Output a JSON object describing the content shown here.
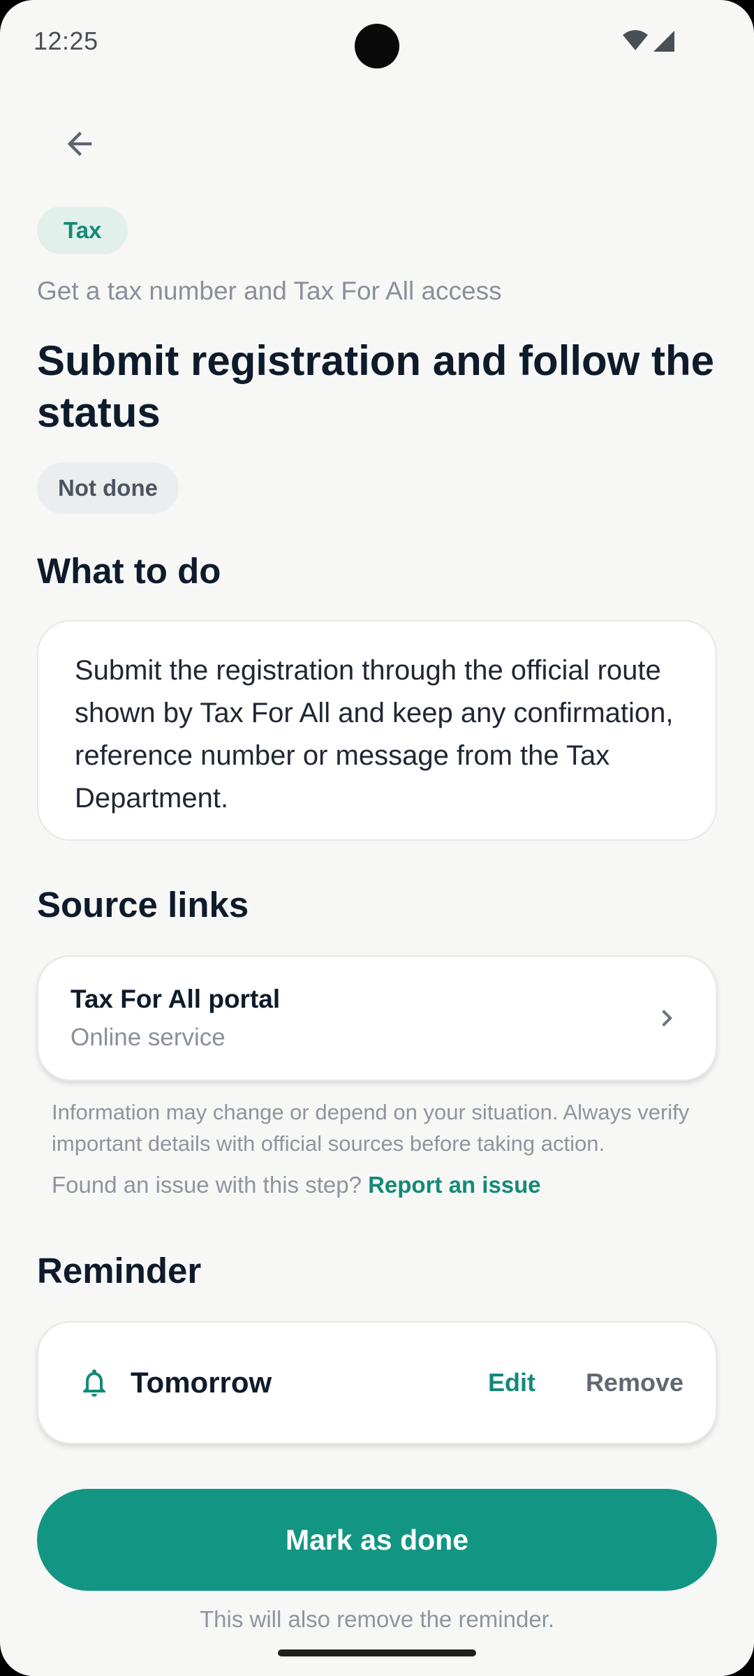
{
  "status_bar": {
    "time": "12:25",
    "icons": [
      "wifi-icon",
      "cellular-signal-icon"
    ]
  },
  "nav": {
    "back_icon": "arrow-back-icon"
  },
  "category": "Tax",
  "subtitle": "Get a tax number and Tax For All access",
  "title": "Submit registration and follow the status",
  "status": "Not done",
  "what_to_do": {
    "heading": "What to do",
    "text": "Submit the registration through the official route shown by Tax For All and keep any confirmation, reference number or message from the Tax Department."
  },
  "source_links": {
    "heading": "Source links",
    "items": [
      {
        "title": "Tax For All portal",
        "subtitle": "Online service",
        "icon": "chevron-right-icon"
      }
    ]
  },
  "disclaimer": "Information may change or depend on your situation. Always verify important details with official sources before taking action.",
  "issue": {
    "prompt": "Found an issue with this step?",
    "link": "Report an issue"
  },
  "reminder": {
    "heading": "Reminder",
    "label": "Tomorrow",
    "icon": "bell-icon",
    "edit": "Edit",
    "remove": "Remove"
  },
  "primary_action": "Mark as done",
  "footnote": "This will also remove the reminder.",
  "colors": {
    "accent": "#129683",
    "accent_text": "#138A77",
    "background": "#F7F7F6",
    "chip_bg": "#E2F0EC"
  }
}
